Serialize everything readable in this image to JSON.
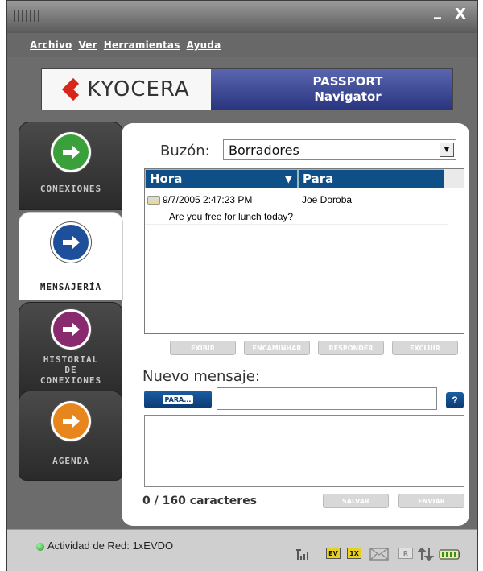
{
  "window": {
    "minimize_glyph": "_",
    "close_glyph": "X"
  },
  "menu": {
    "items": [
      "Archivo",
      "Ver",
      "Herramientas",
      "Ayuda"
    ]
  },
  "banner": {
    "brand": "KYOCERA",
    "product_line1": "PASSPORT",
    "product_line2": "Navigator",
    "brand_color": "#d8261a",
    "product_color": "#2a3580"
  },
  "nav": {
    "items": [
      {
        "label_lines": [
          "CONEXIONES"
        ],
        "icon": "green-arrow-icon",
        "color": "#3aa03a"
      },
      {
        "label_lines": [
          "MENSAJERÍA"
        ],
        "icon": "blue-arrow-icon",
        "color": "#1d4f9a",
        "active": true
      },
      {
        "label_lines": [
          "HISTORIAL",
          "DE",
          "CONEXIONES"
        ],
        "icon": "purple-arrow-icon",
        "color": "#8a2a6e"
      },
      {
        "label_lines": [
          "AGENDA"
        ],
        "icon": "orange-arrow-icon",
        "color": "#e8861e"
      }
    ]
  },
  "mailbox": {
    "label": "Buzón:",
    "selected": "Borradores"
  },
  "list": {
    "columns": [
      "Hora",
      "Para"
    ],
    "rows": [
      {
        "time": "9/7/2005 2:47:23 PM",
        "to": "Joe Doroba",
        "preview": "Are you free for lunch today?"
      }
    ]
  },
  "actions": [
    "EXIBIR",
    "ENCAMINHAR",
    "RESPONDER",
    "EXCLUIR"
  ],
  "compose": {
    "title": "Nuevo mensaje:",
    "to_button": "PARA...",
    "to_value": "",
    "help": "?",
    "counter": "0 / 160 caracteres",
    "save": "SALVAR",
    "send": "ENVIAR"
  },
  "status": {
    "text": "Actividad de Red: 1xEVDO",
    "ev": "EV",
    "onex": "1X",
    "r": "R"
  }
}
